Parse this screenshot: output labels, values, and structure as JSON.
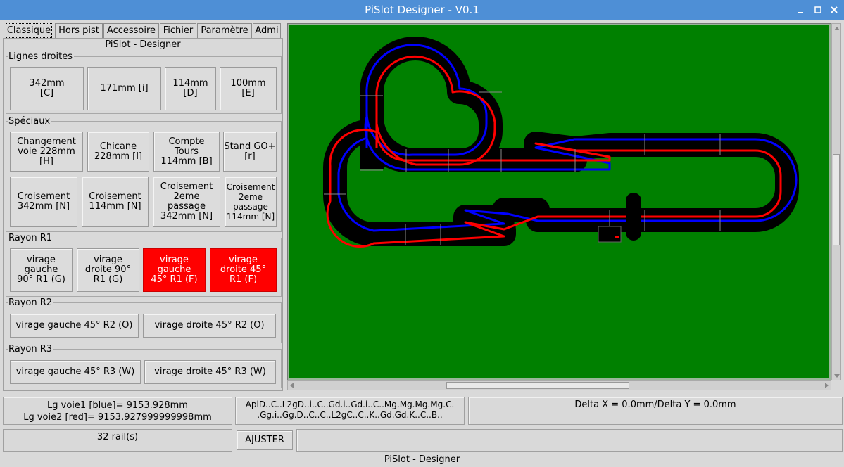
{
  "window": {
    "title": "PiSlot Designer - V0.1"
  },
  "tabs": [
    {
      "label": "Classique"
    },
    {
      "label": "Hors pist"
    },
    {
      "label": "Accessoire"
    },
    {
      "label": "Fichier"
    },
    {
      "label": "Paramètre"
    },
    {
      "label": "Admi"
    }
  ],
  "panel": {
    "title": "PiSlot - Designer",
    "sections": {
      "lignes_droites": {
        "legend": "Lignes droites",
        "buttons": [
          "342mm\n[C]",
          "171mm [i]",
          "114mm\n[D]",
          "100mm\n[E]"
        ]
      },
      "speciaux": {
        "legend": "Spéciaux",
        "buttons": [
          "Changement\nvoie 228mm\n[H]",
          "Chicane\n228mm [I]",
          "Compte\nTours\n114mm [B]",
          "Stand GO+\n[r]",
          "Croisement\n342mm [N]",
          "Croisement\n114mm [N]",
          "Croisement\n2eme\npassage\n342mm [N]",
          "Croisement\n2eme\npassage\n114mm [N]"
        ]
      },
      "rayon_r1": {
        "legend": "Rayon R1",
        "buttons": [
          "virage\ngauche\n90° R1 (G)",
          "virage\ndroite 90°\nR1 (G)",
          "virage\ngauche\n45° R1 (F)",
          "virage\ndroite 45°\nR1 (F)"
        ]
      },
      "rayon_r2": {
        "legend": "Rayon R2",
        "buttons": [
          "virage gauche 45° R2 (O)",
          "virage droite 45° R2 (O)"
        ]
      },
      "rayon_r3": {
        "legend": "Rayon R3",
        "buttons": [
          "virage gauche 45° R3 (W)",
          "virage droite 45° R3 (W)"
        ]
      }
    }
  },
  "status": {
    "lengths_line1": "Lg voie1 [blue]= 9153.928mm",
    "lengths_line2": "Lg voie2 [red]= 9153.927999999998mm",
    "sequence_line1": "AplD..C..L2gD..i..C..Gd.i..Gd.i..C..Mg.Mg.Mg.Mg.C.",
    "sequence_line2": ".Gg.i..Gg.D..C..C..L2gC..C..K..Gd.Gd.K..C..B..",
    "delta": "Delta X = 0.0mm/Delta Y = 0.0mm",
    "rails": "32 rail(s)",
    "adjust_button": "AJUSTER",
    "footer": "PiSlot - Designer"
  },
  "colors": {
    "titlebar": "#4e8fd6",
    "canvas_bg": "#008000",
    "track": "#000000",
    "lane_blue": "#0000ff",
    "lane_red": "#ff0000",
    "selected_button": "#ff0000"
  },
  "icons": [
    "minimize-icon",
    "maximize-icon",
    "close-icon"
  ]
}
